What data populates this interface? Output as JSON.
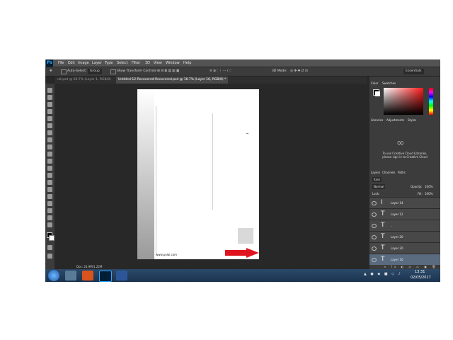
{
  "app": {
    "logo": "Ps"
  },
  "menu": [
    "File",
    "Edit",
    "Image",
    "Layer",
    "Type",
    "Select",
    "Filter",
    "3D",
    "View",
    "Window",
    "Help"
  ],
  "options": {
    "auto_select_label": "Auto-Select:",
    "auto_select_value": "Group",
    "show_transform": "Show Transform Controls",
    "mode_3d": "3D Mode:",
    "workspace": "Essentials"
  },
  "tabs": [
    {
      "label": "ult.psd @ 66.7% (Layer 1, RGB/8)"
    },
    {
      "label": "Untitled-12-Recovered-Recovered.psd @ 16.7% (Layer 16, RGB/8) *"
    }
  ],
  "canvas": {
    "footer_text": "www.polai.com"
  },
  "status": {
    "doc": "Doc: 24.9M/1.22M"
  },
  "panels": {
    "color_tab": "Color",
    "swatches_tab": "Swatches",
    "libraries_tab": "Libraries",
    "adjustments_tab": "Adjustments",
    "styles_tab": "Styles",
    "cc_message": "To use Creative Cloud Libraries, please sign in to Creative Cloud",
    "layers_tab": "Layers",
    "channels_tab": "Channels",
    "paths_tab": "Paths",
    "kind": "Kind",
    "blend_mode": "Normal",
    "opacity_label": "Opacity:",
    "opacity_value": "100%",
    "lock_label": "Lock:",
    "fill_label": "Fill:",
    "fill_value": "100%"
  },
  "layers": [
    {
      "type_icon": "I",
      "name": "Layer 14"
    },
    {
      "type_icon": "T",
      "name": "Layer 12"
    },
    {
      "type_icon": "T",
      "name": ".."
    },
    {
      "type_icon": "T",
      "name": "Layer 20"
    },
    {
      "type_icon": "T",
      "name": "Layer 20"
    },
    {
      "type_icon": "T",
      "name": "Layer 16"
    }
  ],
  "taskbar": {
    "time": "13:31",
    "date": "02/05/2017"
  },
  "colors": {
    "accent": "#31a8ff",
    "arrow": "#e0141e"
  }
}
